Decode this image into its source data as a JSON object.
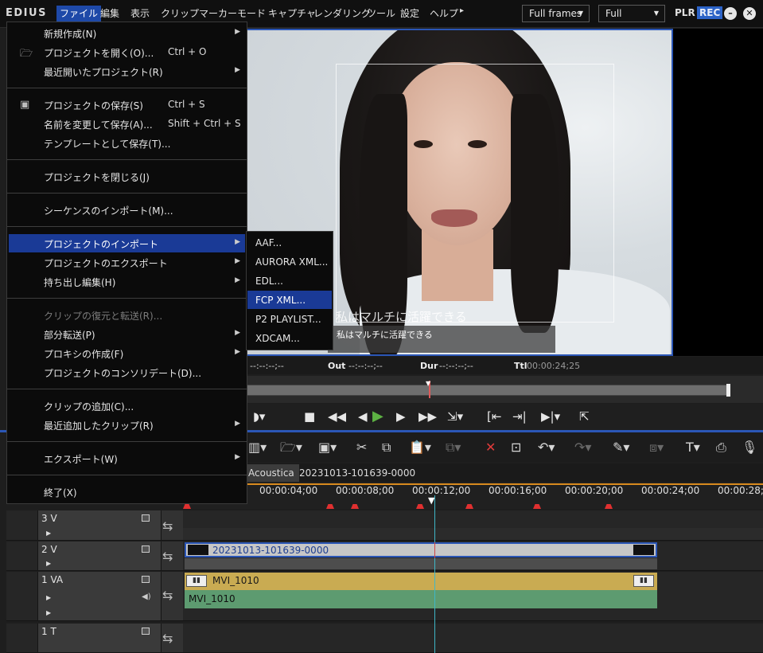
{
  "app": {
    "logo": "EDIUS"
  },
  "menubar": {
    "items": [
      "ファイル",
      "編集",
      "表示",
      "クリップ",
      "マーカー",
      "モード",
      "キャプチャ",
      "レンダリング",
      "ツール",
      "設定",
      "ヘルプ"
    ],
    "more": "▸",
    "frames_dropdown": "Full frames",
    "quality_dropdown": "Full",
    "plr": "PLR",
    "rec": "REC"
  },
  "preview": {
    "caption_large": "私はマルチに活躍できる",
    "caption_small": "私はマルチに活躍できる"
  },
  "timecode": {
    "in_value": "--:--:--;--",
    "out_label": "Out",
    "out_value": "--:--:--;--",
    "dur_label": "Dur",
    "dur_value": "--:--:--;--",
    "ttl_label": "Ttl",
    "ttl_value": "00:00:24;25"
  },
  "sequence_tabs": [
    "Acoustica",
    "20231013-101639-0000"
  ],
  "ruler": {
    "labels": [
      "00:00:04;00",
      "00:00:08;00",
      "00:00:12;00",
      "00:00:16;00",
      "00:00:20;00",
      "00:00:24;00",
      "00:00:28;0"
    ]
  },
  "tracks": [
    {
      "name": "3 V"
    },
    {
      "name": "2 V"
    },
    {
      "name": "1 VA"
    },
    {
      "name": "1 T"
    }
  ],
  "clips": {
    "v2": "20231013-101639-0000",
    "va1_video": "MVI_1010",
    "va1_audio": "MVI_1010"
  },
  "file_menu": {
    "items": [
      {
        "label": "新規作成(N)",
        "shortcut": "",
        "submenu": true
      },
      {
        "label": "プロジェクトを開く(O)...",
        "shortcut": "Ctrl + O",
        "icon": "folder-icon"
      },
      {
        "label": "最近開いたプロジェクト(R)",
        "shortcut": "",
        "submenu": true
      },
      {
        "label": "プロジェクトの保存(S)",
        "shortcut": "Ctrl + S",
        "icon": "save-icon"
      },
      {
        "label": "名前を変更して保存(A)...",
        "shortcut": "Shift + Ctrl + S"
      },
      {
        "label": "テンプレートとして保存(T)..."
      },
      {
        "label": "プロジェクトを閉じる(J)"
      },
      {
        "label": "シーケンスのインポート(M)..."
      },
      {
        "label": "プロジェクトのインポート",
        "submenu": true
      },
      {
        "label": "プロジェクトのエクスポート",
        "submenu": true
      },
      {
        "label": "持ち出し編集(H)",
        "submenu": true
      },
      {
        "label": "クリップの復元と転送(R)..."
      },
      {
        "label": "部分転送(P)",
        "submenu": true
      },
      {
        "label": "プロキシの作成(F)",
        "submenu": true
      },
      {
        "label": "プロジェクトのコンソリデート(D)..."
      },
      {
        "label": "クリップの追加(C)..."
      },
      {
        "label": "最近追加したクリップ(R)",
        "submenu": true
      },
      {
        "label": "エクスポート(W)",
        "submenu": true
      },
      {
        "label": "終了(X)"
      }
    ]
  },
  "import_submenu": [
    "AAF...",
    "AURORA XML...",
    "EDL...",
    "FCP XML...",
    "P2 PLAYLIST...",
    "XDCAM..."
  ],
  "colors": {
    "accent": "#2b56b6",
    "highlight": "#1a3a96",
    "clip_video": "#c9ab52",
    "clip_audio": "#5d9b70"
  }
}
